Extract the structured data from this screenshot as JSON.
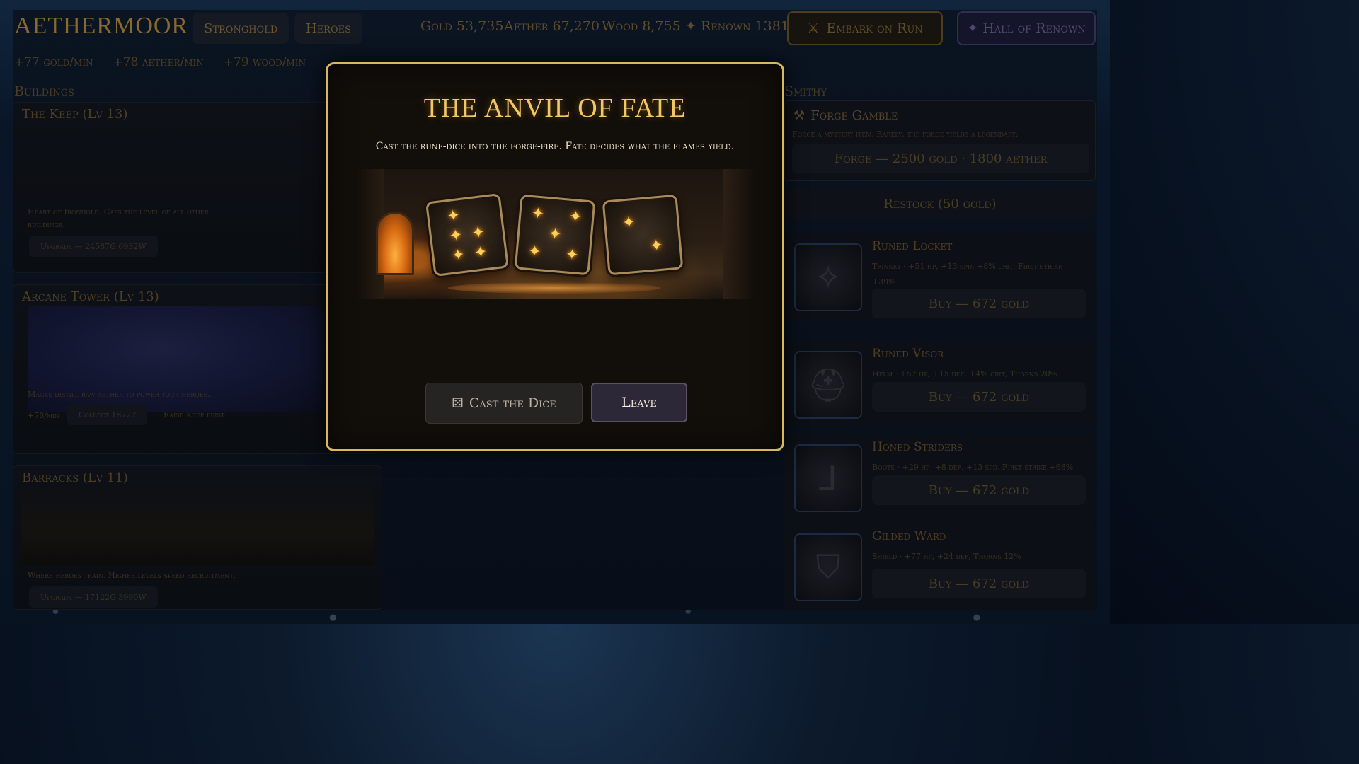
{
  "app": {
    "logo": "Aethermoor"
  },
  "nav": {
    "stronghold": "Stronghold",
    "heroes": "Heroes"
  },
  "resources": {
    "gold": "Gold 53,735",
    "aether": "Aether 67,270",
    "wood": "Wood 8,755",
    "renown": "✦ Renown 1381"
  },
  "actions": {
    "embark": "Embark on Run",
    "hall": "✦ Hall of Renown"
  },
  "rates": [
    "+77 gold/min",
    "+78 aether/min",
    "+79 wood/min"
  ],
  "buildings": {
    "title": "Buildings",
    "keep": {
      "name": "The Keep   (Lv 13)",
      "desc": "Heart of Ironhold. Caps the level of all other buildings.",
      "upgrade": "Upgrade — 24587G 6932W"
    },
    "arcane": {
      "name": "Arcane Tower   (Lv 13)",
      "desc": "Mages distill raw aether to power your heroes.",
      "rate": "+78/min",
      "collect": "Collect 18727",
      "raise": "Raise Keep first"
    },
    "barracks": {
      "name": "Barracks   (Lv 11)",
      "desc": "Where heroes train. Higher levels speed recruitment.",
      "upgrade": "Upgrade — 17122G 3990W"
    }
  },
  "smithy": {
    "title": "Smithy",
    "gamble": {
      "title": "Forge Gamble",
      "desc": "Forge a mystery item. Rarely, the forge yields a legendary.",
      "button": "Forge — 2500 gold · 1800 aether"
    },
    "restock": "Restock (50 gold)",
    "items": [
      {
        "name": "Runed Locket",
        "stats": "Trinket · +51 hp, +13 spd, +8% crit, First strike +39%",
        "buy": "Buy — 672 gold",
        "icon": "amulet-icon"
      },
      {
        "name": "Runed Visor",
        "stats": "Helm · +57 hp, +15 def, +4% crit, Thorns 20%",
        "buy": "Buy — 672 gold",
        "icon": "helmet-icon"
      },
      {
        "name": "Honed Striders",
        "stats": "Boots · +29 hp, +8 def, +13 spd, First strike +68%",
        "buy": "Buy — 672 gold",
        "icon": "boots-icon"
      },
      {
        "name": "Gilded Ward",
        "stats": "Shield · +77 hp, +24 def, Thorns 12%",
        "buy": "Buy — 672 gold",
        "icon": "shield-icon"
      }
    ]
  },
  "modal": {
    "title": "The Anvil of Fate",
    "subtitle": "Cast the rune-dice into the forge-fire. Fate decides what the flames yield.",
    "dice_faces": [
      5,
      5,
      2
    ],
    "cast_label": "Cast the Dice",
    "leave_label": "Leave"
  },
  "colors": {
    "modal_border": "#d8b760",
    "title_gold": "#f2c766",
    "pip_glow": "#ffcf5a"
  }
}
